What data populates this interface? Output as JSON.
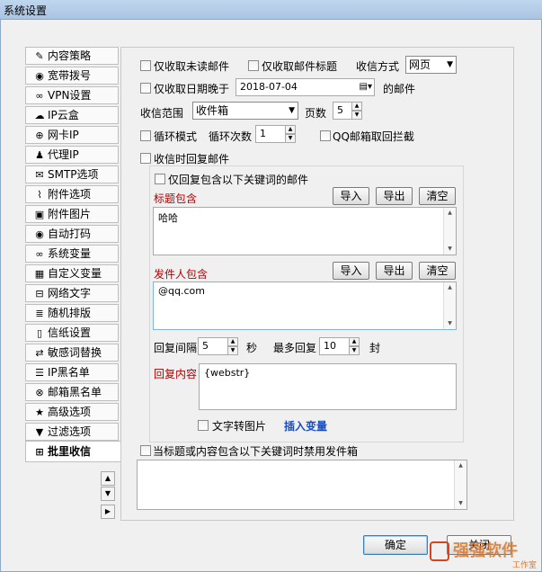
{
  "window": {
    "title": "系统设置"
  },
  "tabs": [
    {
      "label": "内容策略",
      "icon": "✎",
      "icon_name": "pencil-icon"
    },
    {
      "label": "宽带拨号",
      "icon": "◉",
      "icon_name": "globe-icon"
    },
    {
      "label": "VPN设置",
      "icon": "∞",
      "icon_name": "link-icon"
    },
    {
      "label": "IP云盒",
      "icon": "☁",
      "icon_name": "cloud-icon"
    },
    {
      "label": "网卡IP",
      "icon": "⊕",
      "icon_name": "globe-grid-icon"
    },
    {
      "label": "代理IP",
      "icon": "♟",
      "icon_name": "user-tree-icon"
    },
    {
      "label": "SMTP选项",
      "icon": "✉",
      "icon_name": "envelope-icon"
    },
    {
      "label": "附件选项",
      "icon": "⌇",
      "icon_name": "paperclip-icon"
    },
    {
      "label": "附件图片",
      "icon": "▣",
      "icon_name": "image-icon"
    },
    {
      "label": "自动打码",
      "icon": "◉",
      "icon_name": "eye-icon"
    },
    {
      "label": "系统变量",
      "icon": "∞",
      "icon_name": "infinity-icon"
    },
    {
      "label": "自定义变量",
      "icon": "▦",
      "icon_name": "grid-icon"
    },
    {
      "label": "网络文字",
      "icon": "⊟",
      "icon_name": "book-icon"
    },
    {
      "label": "随机排版",
      "icon": "≣",
      "icon_name": "layers-icon"
    },
    {
      "label": "信纸设置",
      "icon": "▯",
      "icon_name": "document-icon"
    },
    {
      "label": "敏感词替换",
      "icon": "⇄",
      "icon_name": "shuffle-icon"
    },
    {
      "label": "IP黑名单",
      "icon": "☰",
      "icon_name": "list-icon"
    },
    {
      "label": "邮箱黑名单",
      "icon": "⊗",
      "icon_name": "block-icon"
    },
    {
      "label": "高级选项",
      "icon": "★",
      "icon_name": "star-icon"
    },
    {
      "label": "过滤选项",
      "icon": "▼",
      "icon_name": "filter-icon"
    },
    {
      "label": "批里收信",
      "icon": "⊞",
      "icon_name": "inbox-icon"
    }
  ],
  "scroll_buttons": [
    "▲",
    "▼",
    "▶"
  ],
  "form": {
    "unread_only": "仅收取未读邮件",
    "subject_only": "仅收取邮件标题",
    "receive_mode_label": "收信方式",
    "receive_mode_value": "网页",
    "date_after_label": "仅收取日期晚于",
    "date_value": "2018-07-04",
    "date_suffix": "的邮件",
    "scope_label": "收信范围",
    "scope_value": "收件箱",
    "pages_label": "页数",
    "pages_value": "5",
    "loop_mode": "循环模式",
    "loop_count_label": "循环次数",
    "loop_count_value": "1",
    "qq_intercept": "QQ邮箱取回拦截",
    "reply_on_receive": "收信时回复邮件",
    "reply_keyword_only": "仅回复包含以下关键词的邮件",
    "subject_contains_label": "标题包含",
    "subject_contains_value": "哈哈",
    "sender_contains_label": "发件人包含",
    "sender_contains_value": "@qq.com",
    "import_label": "导入",
    "export_label": "导出",
    "clear_label": "清空",
    "reply_interval_label": "回复间隔",
    "reply_interval_value": "5",
    "seconds_label": "秒",
    "max_reply_label": "最多回复",
    "max_reply_value": "10",
    "letters_label": "封",
    "reply_content_label": "回复内容",
    "reply_content_value": "{webstr}",
    "text_to_image": "文字转图片",
    "insert_variable": "插入变量",
    "disable_sender": "当标题或内容包含以下关键词时禁用发件箱",
    "disable_sender_value": ""
  },
  "footer": {
    "ok_label": "确定",
    "close_label": "关闭"
  },
  "watermark": {
    "line1": "强强软件",
    "line2": "工作室"
  }
}
